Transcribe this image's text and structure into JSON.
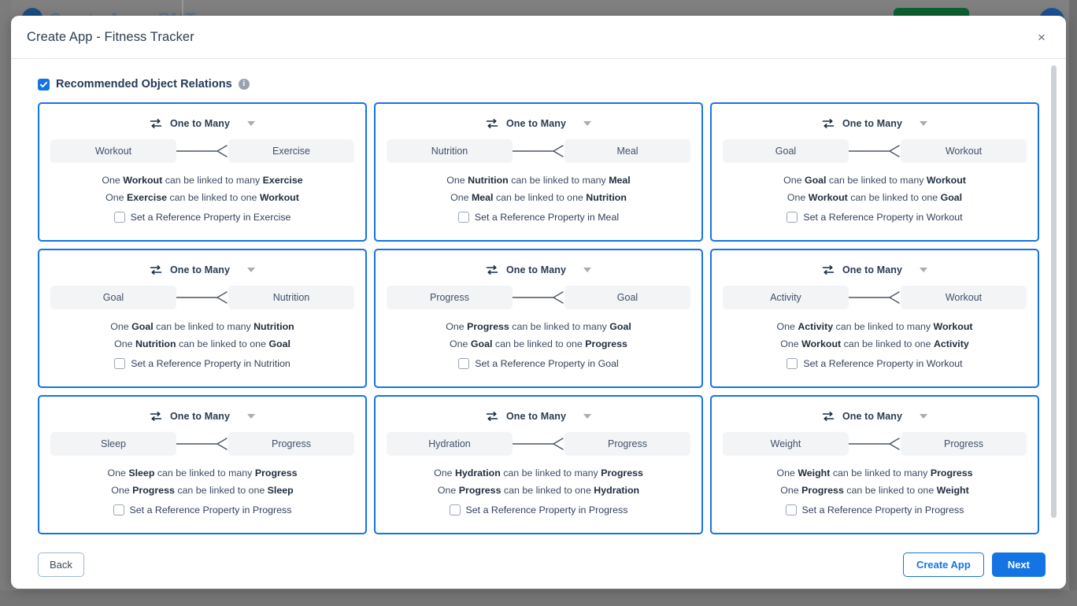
{
  "background": {
    "app_title": "Create App - BMT",
    "green_button_label": "",
    "avatar_label": ""
  },
  "modal": {
    "title": "Create App - Fitness Tracker",
    "close_icon_label": "×"
  },
  "section": {
    "checkbox_checked": true,
    "title": "Recommended Object Relations",
    "info_icon_label": "i"
  },
  "common": {
    "relation_type": "One to Many",
    "desc_prefix": "One",
    "desc_mid_many": "can be linked to many",
    "desc_mid_one": "can be linked to one",
    "ref_prefix": "Set a Reference Property in"
  },
  "cards": [
    {
      "relation_type": "One to Many",
      "left_entity": "Workout",
      "right_entity": "Exercise",
      "desc_many": "One Workout can be linked to many Exercise",
      "desc_one": "One Exercise can be linked to one Workout",
      "ref_label": "Set a Reference Property in Exercise",
      "ref_checked": false
    },
    {
      "relation_type": "One to Many",
      "left_entity": "Nutrition",
      "right_entity": "Meal",
      "desc_many": "One Nutrition can be linked to many Meal",
      "desc_one": "One Meal can be linked to one Nutrition",
      "ref_label": "Set a Reference Property in Meal",
      "ref_checked": false
    },
    {
      "relation_type": "One to Many",
      "left_entity": "Goal",
      "right_entity": "Workout",
      "desc_many": "One Goal can be linked to many Workout",
      "desc_one": "One Workout can be linked to one Goal",
      "ref_label": "Set a Reference Property in Workout",
      "ref_checked": false
    },
    {
      "relation_type": "One to Many",
      "left_entity": "Goal",
      "right_entity": "Nutrition",
      "desc_many": "One Goal can be linked to many Nutrition",
      "desc_one": "One Nutrition can be linked to one Goal",
      "ref_label": "Set a Reference Property in Nutrition",
      "ref_checked": false
    },
    {
      "relation_type": "One to Many",
      "left_entity": "Progress",
      "right_entity": "Goal",
      "desc_many": "One Progress can be linked to many Goal",
      "desc_one": "One Goal can be linked to one Progress",
      "ref_label": "Set a Reference Property in Goal",
      "ref_checked": false
    },
    {
      "relation_type": "One to Many",
      "left_entity": "Activity",
      "right_entity": "Workout",
      "desc_many": "One Activity can be linked to many Workout",
      "desc_one": "One Workout can be linked to one Activity",
      "ref_label": "Set a Reference Property in Workout",
      "ref_checked": false
    },
    {
      "relation_type": "One to Many",
      "left_entity": "Sleep",
      "right_entity": "Progress",
      "desc_many": "One Sleep can be linked to many Progress",
      "desc_one": "One Progress can be linked to one Sleep",
      "ref_label": "Set a Reference Property in Progress",
      "ref_checked": false
    },
    {
      "relation_type": "One to Many",
      "left_entity": "Hydration",
      "right_entity": "Progress",
      "desc_many": "One Hydration can be linked to many Progress",
      "desc_one": "One Progress can be linked to one Hydration",
      "ref_label": "Set a Reference Property in Progress",
      "ref_checked": false
    },
    {
      "relation_type": "One to Many",
      "left_entity": "Weight",
      "right_entity": "Progress",
      "desc_many": "One Weight can be linked to many Progress",
      "desc_one": "One Progress can be linked to one Weight",
      "ref_label": "Set a Reference Property in Progress",
      "ref_checked": false
    }
  ],
  "footer": {
    "back_label": "Back",
    "create_app_label": "Create App",
    "next_label": "Next"
  },
  "colors": {
    "accent_blue": "#1474e4",
    "card_border": "#1474e4",
    "pill_bg": "#f2f4f6",
    "text_dark": "#253858",
    "overlay": "#808080"
  }
}
